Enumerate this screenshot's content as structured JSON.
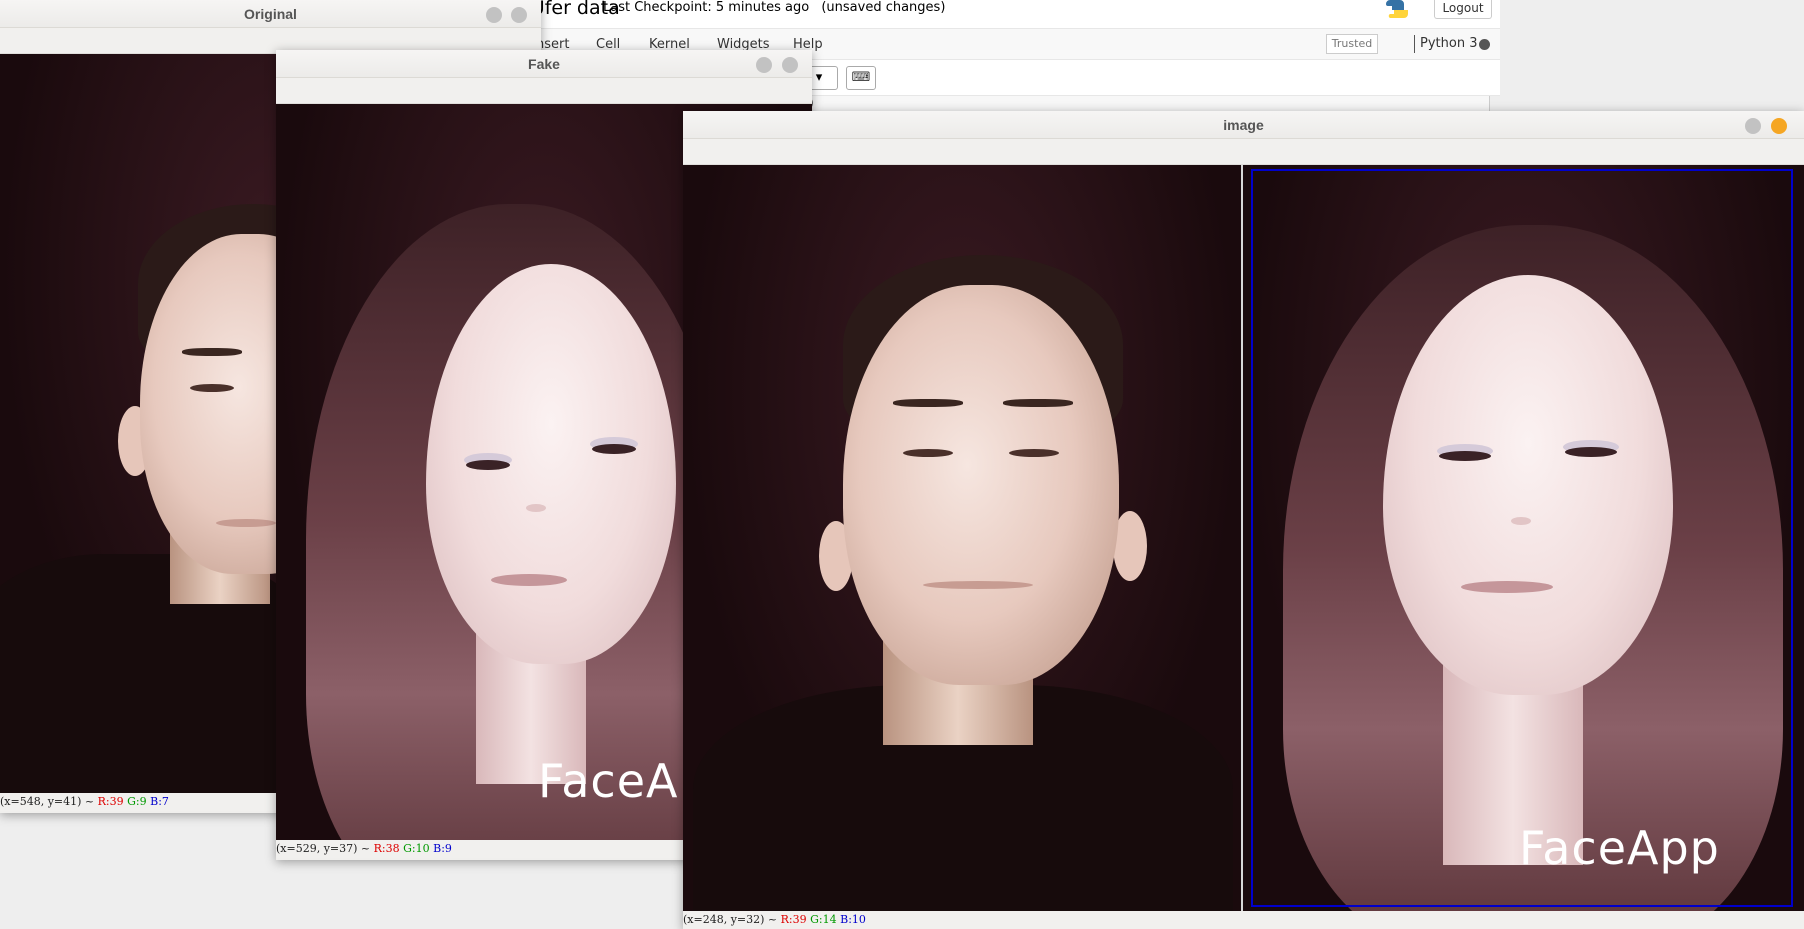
{
  "notebook": {
    "title": "...bmayak - Lk Ufer data",
    "checkpoint": "Last Checkpoint: 5 minutes ago",
    "unsaved": "(unsaved changes)",
    "logout_label": "Logout",
    "menu": [
      "nsert",
      "Cell",
      "Kernel",
      "Widgets",
      "Help"
    ],
    "trusted_label": "Trusted",
    "kernel_name": "Python 3",
    "cell_type_glyph": "▾",
    "keyboard_glyph": "⌨",
    "cell_text": ")"
  },
  "windows": {
    "original": {
      "title": "Original",
      "status": {
        "coords": "(x=548, y=41) ~",
        "r": "R:39",
        "g": "G:9",
        "b": "B:7"
      }
    },
    "fake": {
      "title": "Fake",
      "watermark": "FaceA",
      "status": {
        "coords": "(x=529, y=37) ~",
        "r": "R:38",
        "g": "G:10",
        "b": "B:9"
      }
    },
    "image": {
      "title": "image",
      "watermark": "FaceApp",
      "status": {
        "coords": "(x=248, y=32) ~",
        "r": "R:39",
        "g": "G:14",
        "b": "B:10"
      }
    }
  },
  "colors": {
    "selection_box": "#0000cc",
    "close_button_active": "#f5a623",
    "photo_background": "#1e0b0e"
  }
}
